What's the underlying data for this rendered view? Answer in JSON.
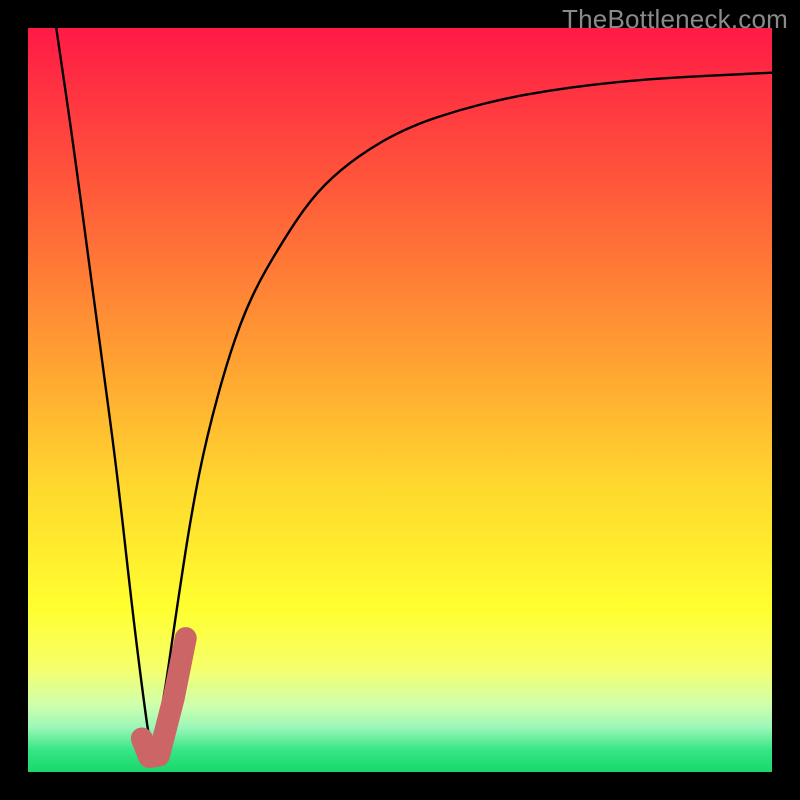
{
  "watermark": "TheBottleneck.com",
  "chart_data": {
    "type": "line",
    "title": "",
    "xlabel": "",
    "ylabel": "",
    "xlim": [
      0,
      100
    ],
    "ylim": [
      0,
      100
    ],
    "grid": false,
    "legend": false,
    "background_gradient_stops": [
      {
        "pct": 0,
        "color": "#ff1a46"
      },
      {
        "pct": 22,
        "color": "#ff5a3a"
      },
      {
        "pct": 45,
        "color": "#ffa232"
      },
      {
        "pct": 62,
        "color": "#ffd92e"
      },
      {
        "pct": 78,
        "color": "#ffff2f"
      },
      {
        "pct": 86,
        "color": "#f6ff6a"
      },
      {
        "pct": 91,
        "color": "#cfffad"
      },
      {
        "pct": 94,
        "color": "#9cf7b8"
      },
      {
        "pct": 97,
        "color": "#38e687"
      },
      {
        "pct": 100,
        "color": "#17d86b"
      }
    ],
    "series": [
      {
        "name": "bottleneck-curve",
        "color": "#000000",
        "stroke_width": 2.4,
        "x": [
          3.8,
          6,
          8,
          10,
          12,
          14,
          15.5,
          16.5,
          18,
          20,
          22,
          24,
          27,
          30,
          34,
          38,
          42,
          47,
          52,
          58,
          64,
          70,
          76,
          82,
          88,
          94,
          100
        ],
        "y": [
          100,
          85,
          70,
          55,
          40,
          22,
          10,
          3,
          8,
          22,
          35,
          45,
          56,
          64,
          71,
          77,
          81,
          84.5,
          87,
          89,
          90.5,
          91.6,
          92.4,
          93,
          93.4,
          93.7,
          94
        ]
      },
      {
        "name": "target-marker",
        "color": "#cc6666",
        "stroke_width": 22,
        "linecap": "round",
        "x": [
          15.3,
          16.3,
          17.6,
          19.6,
          21.2
        ],
        "y": [
          4.5,
          2.0,
          2.2,
          10,
          18
        ]
      }
    ]
  }
}
